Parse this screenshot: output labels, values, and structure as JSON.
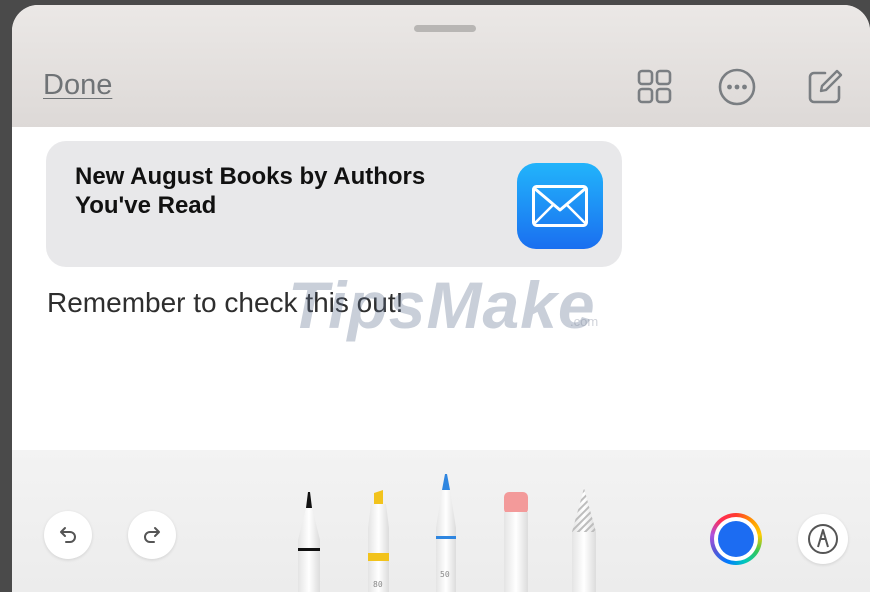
{
  "header": {
    "done_label": "Done",
    "icons": [
      "grid-view-icon",
      "more-options-icon",
      "compose-icon"
    ]
  },
  "link_card": {
    "title": "New August Books by Authors You've Read",
    "icon": "mail-app-icon"
  },
  "note": {
    "body": "Remember to check this out!"
  },
  "watermark": {
    "brand": "TipsMake",
    "suffix": ".com"
  },
  "toolbar": {
    "undo_icon": "undo-icon",
    "redo_icon": "redo-icon",
    "tools": [
      {
        "name": "pen",
        "color": "#111111"
      },
      {
        "name": "marker",
        "color": "#f2c31c",
        "width_label": "80"
      },
      {
        "name": "pencil",
        "color": "#2f86e0",
        "width_label": "50"
      },
      {
        "name": "eraser",
        "color": "#f39a9a"
      },
      {
        "name": "ruler",
        "color": "#bfbfbf"
      }
    ],
    "selected_color": "#1c6cf2",
    "markup_icon": "markup-icon"
  }
}
